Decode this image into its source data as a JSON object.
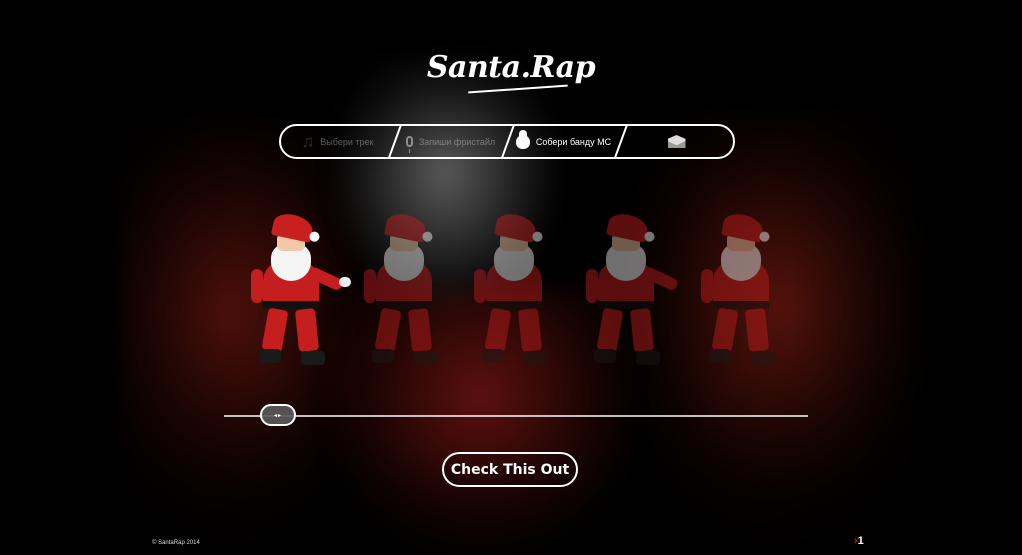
{
  "logo": {
    "text": "Santa.Rap"
  },
  "steps": [
    {
      "label": "Выбери трек",
      "icon": "music-note-icon",
      "active": false
    },
    {
      "label": "Запиши фристайл",
      "icon": "microphone-icon",
      "active": false
    },
    {
      "label": "Собери банду МС",
      "icon": "santa-head-icon",
      "active": true
    },
    {
      "label": "",
      "icon": "envelope-icon",
      "active": false
    }
  ],
  "santas": [
    {
      "label": "santa-dancer-1",
      "selected": true
    },
    {
      "label": "santa-dancer-2",
      "selected": false
    },
    {
      "label": "santa-dancer-3",
      "selected": false
    },
    {
      "label": "santa-dancer-4",
      "selected": false
    },
    {
      "label": "santa-dancer-5",
      "selected": false
    }
  ],
  "slider": {
    "handle_glyph": "◂▸",
    "position_fraction": 0.07
  },
  "cta": {
    "label": "Check This Out"
  },
  "footer": {
    "copyright": "© SantaRap 2014",
    "brand_mark": "1"
  },
  "colors": {
    "accent_red": "#c41e1e",
    "outline": "#ffffff",
    "background": "#000000"
  }
}
